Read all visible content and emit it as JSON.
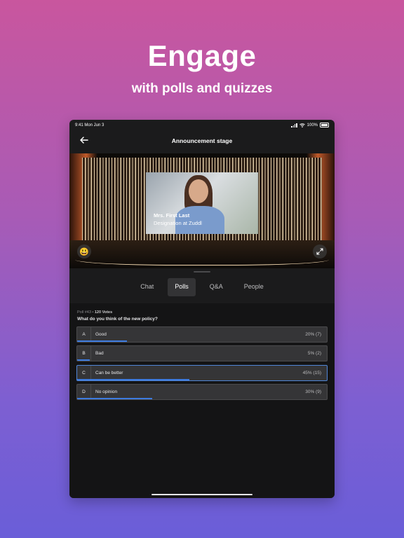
{
  "headline": "Engage",
  "subline": "with polls and quizzes",
  "status": {
    "time": "9:41  Mon Jun 3",
    "battery": "100%"
  },
  "nav": {
    "title": "Announcement stage",
    "back_icon": "arrow-left-icon"
  },
  "video": {
    "name": "Mrs. First Last",
    "designation": "Designation at Zuddl"
  },
  "stage_controls": {
    "emoji": "😃",
    "expand_icon": "expand-icon"
  },
  "tabs": [
    {
      "label": "Chat",
      "active": false
    },
    {
      "label": "Polls",
      "active": true
    },
    {
      "label": "Q&A",
      "active": false
    },
    {
      "label": "People",
      "active": false
    }
  ],
  "poll": {
    "number": "Poll #43",
    "votes": "120 Votes",
    "question": "What do you think of the new policy?",
    "options": [
      {
        "letter": "A",
        "label": "Good",
        "result": "20% (7)",
        "percent": 20,
        "selected": false
      },
      {
        "letter": "B",
        "label": "Bad",
        "result": "5% (2)",
        "percent": 5,
        "selected": false
      },
      {
        "letter": "C",
        "label": "Can be better",
        "result": "45% (15)",
        "percent": 45,
        "selected": true
      },
      {
        "letter": "D",
        "label": "No opinion",
        "result": "30% (9)",
        "percent": 30,
        "selected": false
      }
    ]
  },
  "colors": {
    "accent": "#3d7be0",
    "selected_border": "#4f86d8"
  }
}
